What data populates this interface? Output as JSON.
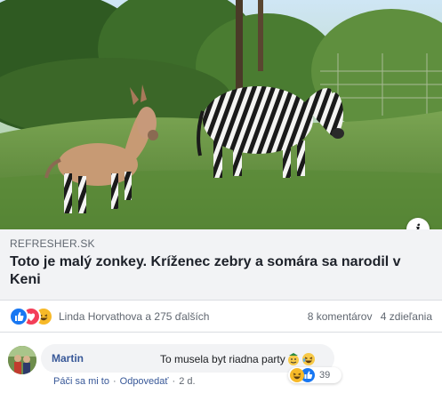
{
  "image": {
    "description_alt": "",
    "info_icon": "info-icon"
  },
  "link": {
    "domain": "REFRESHER.SK",
    "title": "Toto je malý zonkey. Kríženec zebry a somára sa narodil v Keni"
  },
  "reactions": {
    "icons": [
      "like-icon",
      "love-icon",
      "haha-icon"
    ],
    "reactors_text": "Linda Horvathova a 275 ďalších",
    "comments_count": "8 komentárov",
    "shares_count": "4 zdieľania"
  },
  "comment": {
    "author": "Martin",
    "text": "To musela byt riadna party",
    "reaction_count": "39",
    "actions": {
      "like": "Páči sa mi to",
      "reply": "Odpovedať",
      "time": "2 d."
    }
  },
  "colors": {
    "link_blue": "#385898",
    "like_blue": "#1877f2",
    "love_red": "#f33e58",
    "haha_yellow": "#f7b928"
  }
}
